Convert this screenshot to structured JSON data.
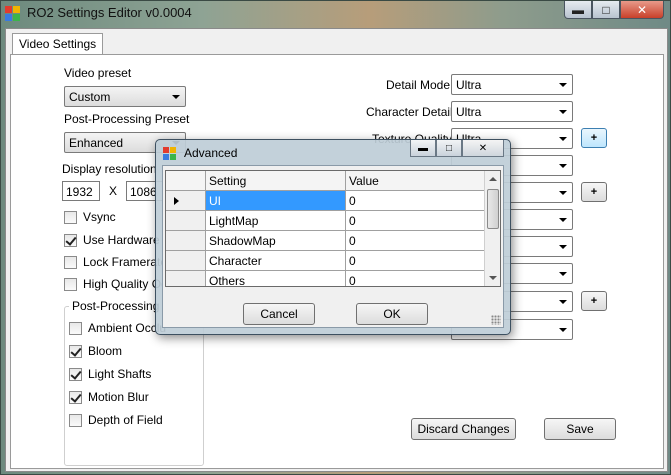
{
  "window": {
    "title": "RO2 Settings Editor v0.0004",
    "minimize_glyph": "▬",
    "maximize_glyph": "□",
    "close_glyph": "✕"
  },
  "tabs": [
    {
      "label": "Video Settings"
    }
  ],
  "left": {
    "video_preset_label": "Video preset",
    "video_preset_value": "Custom",
    "post_processing_preset_label": "Post-Processing Preset",
    "post_processing_preset_value": "Enhanced",
    "display_resolution_label": "Display resolution",
    "resolution_width": "1932",
    "resolution_x": "X",
    "resolution_height": "1086",
    "checkboxes": [
      {
        "label": "Vsync",
        "checked": false
      },
      {
        "label": "Use Hardware P",
        "checked": true
      },
      {
        "label": "Lock Framerate",
        "checked": false
      },
      {
        "label": "High Quality Oc",
        "checked": false
      }
    ],
    "post_processing_group": {
      "legend": "Post-Processing E",
      "checkboxes": [
        {
          "label": "Ambient Occlu",
          "checked": false
        },
        {
          "label": "Bloom",
          "checked": true
        },
        {
          "label": "Light Shafts",
          "checked": true
        },
        {
          "label": "Motion Blur",
          "checked": true
        },
        {
          "label": "Depth of Field",
          "checked": false
        }
      ]
    }
  },
  "right": {
    "detail_mode_label": "Detail Mode",
    "detail_mode_value": "Ultra",
    "character_detail_label": "Character Detail",
    "character_detail_value": "Ultra",
    "texture_quality_label": "Texture Quality",
    "texture_quality_value": "Ultra",
    "plus_label": "+"
  },
  "buttons": {
    "discard": "Discard Changes",
    "save": "Save"
  },
  "dialog": {
    "title": "Advanced",
    "columns": [
      "Setting",
      "Value"
    ],
    "rows": [
      {
        "setting": "UI",
        "value": "0"
      },
      {
        "setting": "LightMap",
        "value": "0"
      },
      {
        "setting": "ShadowMap",
        "value": "0"
      },
      {
        "setting": "Character",
        "value": "0"
      },
      {
        "setting": "Others",
        "value": "0"
      }
    ],
    "cancel": "Cancel",
    "ok": "OK"
  }
}
